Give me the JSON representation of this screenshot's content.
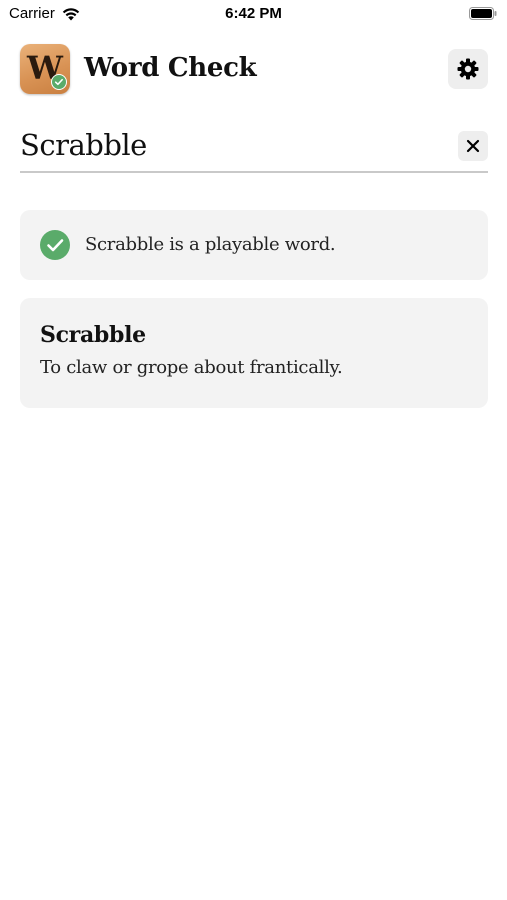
{
  "status_bar": {
    "carrier": "Carrier",
    "time": "6:42 PM",
    "icons": [
      "wifi-icon",
      "battery-icon"
    ]
  },
  "header": {
    "app_icon_letter": "W",
    "app_icon_badge": "check-badge-icon",
    "title": "Word Check",
    "settings_icon": "gear-icon"
  },
  "search": {
    "value": "Scrabble",
    "clear_icon": "close-icon"
  },
  "result": {
    "icon": "check-circle-icon",
    "text": "Scrabble is a playable word."
  },
  "definition": {
    "word": "Scrabble",
    "text": "To claw or grope about frantically."
  },
  "colors": {
    "success": "#5aab6a",
    "card_background": "#f3f3f3",
    "button_background": "#eeeeee",
    "app_icon": "#d99355"
  }
}
